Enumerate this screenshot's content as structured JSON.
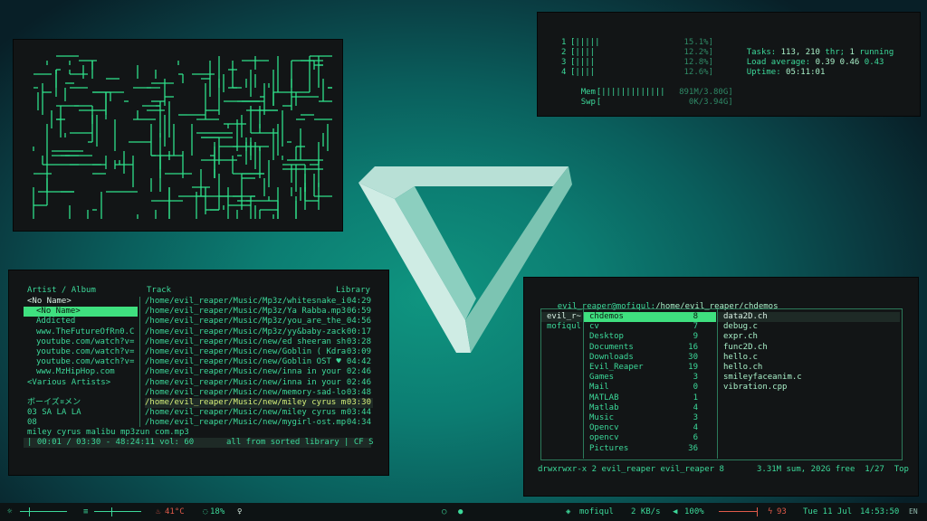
{
  "htop": {
    "cpus": [
      {
        "num": "1",
        "bar": "[|||||",
        "pct": "15.1%]"
      },
      {
        "num": "2",
        "bar": "[||||",
        "pct": "12.2%]"
      },
      {
        "num": "3",
        "bar": "[||||",
        "pct": "12.8%]"
      },
      {
        "num": "4",
        "bar": "[||||",
        "pct": "12.6%]"
      }
    ],
    "mem": {
      "label": "Mem",
      "bar": "[|||||||||||||",
      "val": "891M/3.80G]"
    },
    "swp": {
      "label": "Swp",
      "bar": "[",
      "val": "0K/3.94G]"
    },
    "tasks_label": "Tasks:",
    "tasks_val": "113, 210",
    "tasks_thr": "thr;",
    "tasks_run_num": "1",
    "tasks_run": "running",
    "load_label": "Load average:",
    "load_1": "0.39",
    "load_5": "0.46",
    "load_15": "0.43",
    "uptime_label": "Uptime:",
    "uptime_val": "05:11:01"
  },
  "cmus": {
    "left_header": "Artist / Album",
    "track_header": "Track",
    "right_header": "Library",
    "artists": [
      "<No Name>",
      "<No Name>",
      "Addicted",
      "www.TheFutureOfRn0.C",
      "youtube.com/watch?v=",
      "youtube.com/watch?v=",
      "youtube.com/watch?v=",
      "www.MzHipHop.com",
      "<Various Artists>",
      "",
      "ボーイズ¤メン",
      "03 SA LA LA",
      "08"
    ],
    "tracks": [
      {
        "path": "/home/evil_reaper/Music/Mp3z/whitesnake_i",
        "dur": "04:29"
      },
      {
        "path": "/home/evil_reaper/Music/Mp3z/Ya Rabba.mp3",
        "dur": "06:59"
      },
      {
        "path": "/home/evil_reaper/Music/Mp3z/you_are_the_",
        "dur": "04:56"
      },
      {
        "path": "/home/evil_reaper/Music/Mp3z/yy&baby-zack",
        "dur": "00:17"
      },
      {
        "path": "/home/evil_reaper/Music/new/ed sheeran sh",
        "dur": "03:28"
      },
      {
        "path": "/home/evil_reaper/Music/new/Goblin ( Kdra",
        "dur": "03:09"
      },
      {
        "path": "/home/evil_reaper/Music/new/Goblin OST ♥",
        "dur": "04:42"
      },
      {
        "path": "/home/evil_reaper/Music/new/inna in your",
        "dur": "02:46"
      },
      {
        "path": "/home/evil_reaper/Music/new/inna in your",
        "dur": "02:46"
      },
      {
        "path": "/home/evil_reaper/Music/new/memory-sad-lo",
        "dur": "03:48"
      },
      {
        "path": "/home/evil_reaper/Music/new/miley cyrus m",
        "dur": "03:30"
      },
      {
        "path": "/home/evil_reaper/Music/new/miley cyrus m",
        "dur": "03:44"
      },
      {
        "path": "/home/evil_reaper/Music/new/mygirl-ost.mp",
        "dur": "04:34"
      }
    ],
    "now_playing": "miley cyrus malibu mp3zun com.mp3",
    "status_left": "| 00:01 / 03:30 - 48:24:11 vol: 60",
    "status_right": "all from sorted library | CF S"
  },
  "ranger": {
    "title": "evil_reaper@mofiqul:/home/evil_reaper/chdemos",
    "col1": [
      "evil_r~",
      "mofiqul"
    ],
    "col2": [
      {
        "name": "chdemos",
        "count": "8"
      },
      {
        "name": "cv",
        "count": "7"
      },
      {
        "name": "Desktop",
        "count": "9"
      },
      {
        "name": "Documents",
        "count": "16"
      },
      {
        "name": "Downloads",
        "count": "30"
      },
      {
        "name": "Evil_Reaper",
        "count": "19"
      },
      {
        "name": "Games",
        "count": "3"
      },
      {
        "name": "Mail",
        "count": "0"
      },
      {
        "name": "MATLAB",
        "count": "1"
      },
      {
        "name": "Matlab",
        "count": "4"
      },
      {
        "name": "Music",
        "count": "3"
      },
      {
        "name": "Opencv",
        "count": "4"
      },
      {
        "name": "opencv",
        "count": "6"
      },
      {
        "name": "Pictures",
        "count": "36"
      }
    ],
    "col3": [
      "data2D.ch",
      "debug.c",
      "expr.ch",
      "func2D.ch",
      "hello.c",
      "hello.ch",
      "smileyfaceanim.c",
      "vibration.cpp"
    ],
    "status_left": "drwxrwxr-x 2 evil_reaper evil_reaper 8",
    "status_right": "3.31M sum, 202G free  1/27  Top"
  },
  "bar": {
    "temp": "41°C",
    "cpu": "18%",
    "host": "mofiqul",
    "net": "2 KB/s",
    "volume": "100%",
    "battery": "93",
    "date": "Tue 11 Jul",
    "time": "14:53:50",
    "lang": "EN"
  },
  "colors": {
    "accent": "#3cd99a",
    "selection": "#3fe07f",
    "window_bg": "#121516",
    "bar_bg": "#0d1314",
    "warn": "#e05a4a"
  }
}
